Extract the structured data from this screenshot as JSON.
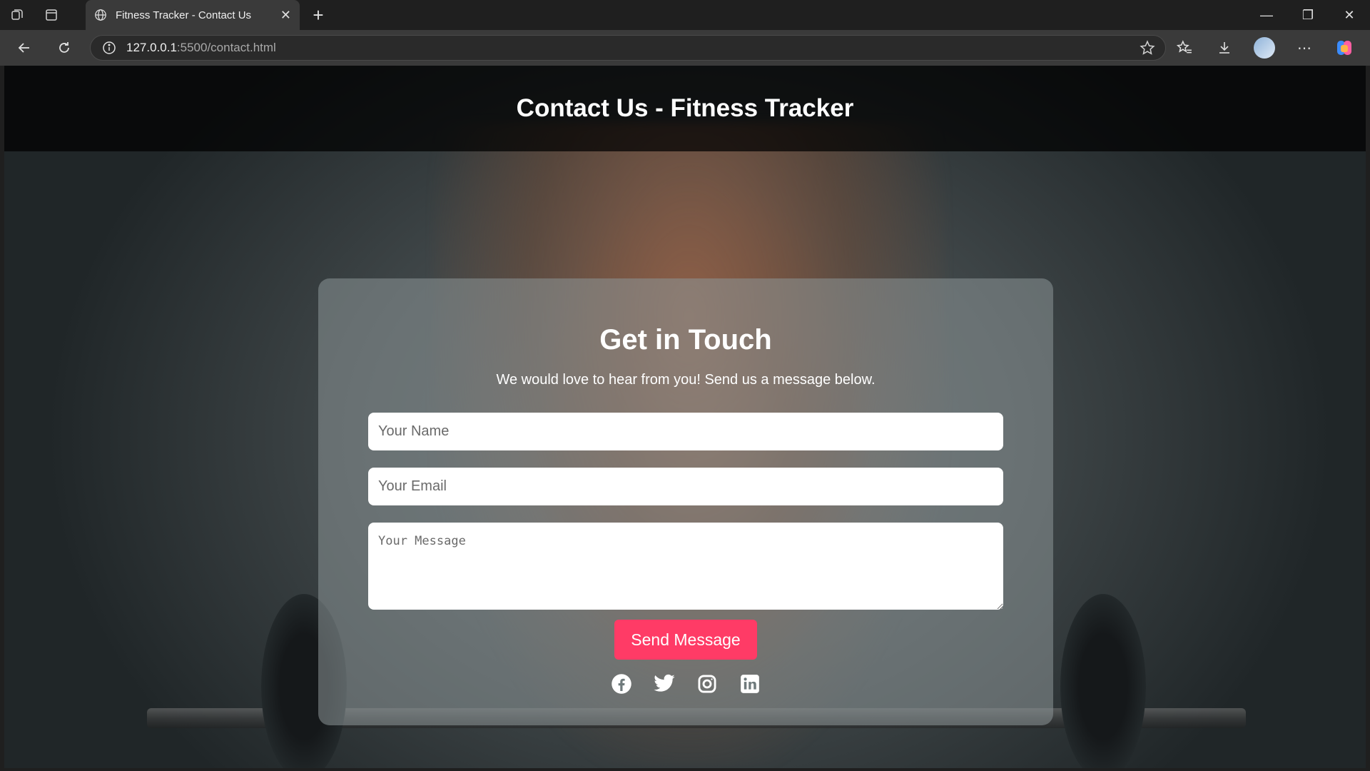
{
  "browser": {
    "tab_title": "Fitness Tracker - Contact Us",
    "url_host": "127.0.0.1",
    "url_path": ":5500/contact.html"
  },
  "header": {
    "title": "Contact Us - Fitness Tracker"
  },
  "contact": {
    "heading": "Get in Touch",
    "subtitle": "We would love to hear from you! Send us a message below.",
    "name_placeholder": "Your Name",
    "email_placeholder": "Your Email",
    "message_placeholder": "Your Message",
    "send_label": "Send Message",
    "button_color": "#ff3b66"
  },
  "socials": [
    "facebook-icon",
    "twitter-icon",
    "instagram-icon",
    "linkedin-icon"
  ]
}
